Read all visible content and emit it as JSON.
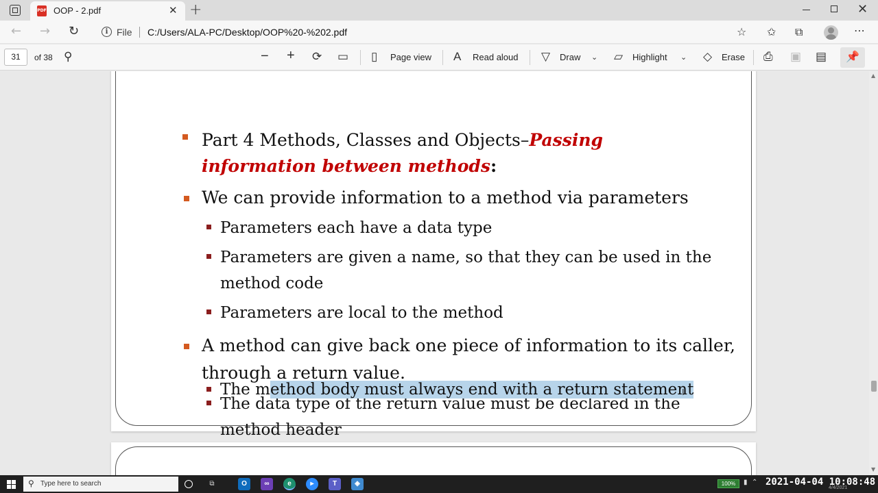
{
  "browser": {
    "tab_title": "OOP - 2.pdf",
    "tab_favicon_text": "PDF",
    "scheme": "File",
    "url": "C:/Users/ALA-PC/Desktop/OOP%20-%202.pdf"
  },
  "pdf_toolbar": {
    "page_current": "31",
    "page_total": "of 38",
    "page_view_label": "Page view",
    "read_aloud_label": "Read aloud",
    "draw_label": "Draw",
    "highlight_label": "Highlight",
    "erase_label": "Erase"
  },
  "slide": {
    "heading_partial": "Part 4 Methods, Classes and Objects–",
    "heading_red_partial": "Passing",
    "heading_red_line2": "information between methods",
    "heading_colon": ":",
    "bullet1": "We can provide information to a method via parameters",
    "bullet1_sub1": "Parameters each have a data type",
    "bullet1_sub2_line1": "Parameters are given a name, so that they can be used in the",
    "bullet1_sub2_line2": "method code",
    "bullet1_sub3": "Parameters are local to the method",
    "bullet2_line1": "A method can give back one piece of information to its caller,",
    "bullet2_line2": "through a return value.",
    "bullet2_sub1_line1": "The data type of the return value must be declared in the",
    "bullet2_sub1_line2": "method header",
    "bullet2_sub2_pre": "The m",
    "bullet2_sub2_highlighted": "ethod body must always end with a return statement"
  },
  "taskbar": {
    "search_placeholder": "Type here to search",
    "battery": "100%",
    "clock": "2021-04-04 10:08:48",
    "small_date": "4/4/2021"
  }
}
